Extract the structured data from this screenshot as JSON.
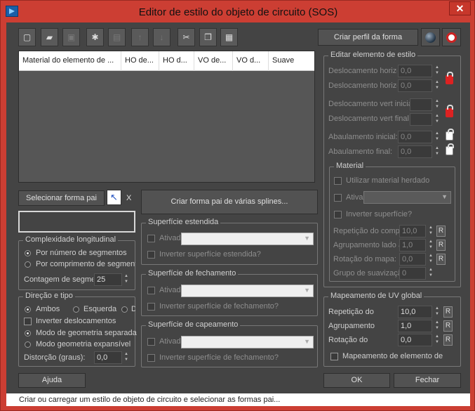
{
  "window": {
    "title": "Editor de estilo do objeto de circuito (SOS)",
    "close": "✕"
  },
  "toolbar": {
    "icons": [
      "new-icon",
      "open-icon",
      "save-icon",
      "add-layer-icon",
      "delete-layer-icon",
      "move-up-icon",
      "move-down-icon",
      "cut-icon",
      "copy-icon",
      "paste-icon"
    ]
  },
  "table": {
    "columns": [
      "Material do elemento de ...",
      "HO de...",
      "HO d...",
      "VO de...",
      "VO d...",
      "Suave"
    ]
  },
  "buttons": {
    "create_profile": "Criar perfil da forma",
    "select_parent": "Selecionar forma pai",
    "clear_x": "X",
    "create_parent_multi": "Criar forma pai de várias splines...",
    "help": "Ajuda",
    "ok": "OK",
    "cancel": "Fechar"
  },
  "complexity": {
    "title": "Complexidade longitudinal",
    "opt_segments": "Por número de segmentos",
    "opt_length": "Por comprimento de segmento",
    "count_label": "Contagem de segmentos",
    "count_value": "25"
  },
  "direction": {
    "title": "Direção e tipo",
    "both": "Ambos",
    "left": "Esquerda",
    "right": "Direita",
    "invert_offsets": "Inverter deslocamentos",
    "separate_geo": "Modo de geometria separada",
    "expandable_geo": "Modo geometria expansível",
    "distortion_label": "Distorção (graus):",
    "distortion_value": "0,0"
  },
  "extended_surface": {
    "title": "Superfície estendida",
    "active": "Ativado",
    "invert": "Inverter superfície estendida?"
  },
  "closing_surface": {
    "title": "Superfície de fechamento",
    "active": "Ativado",
    "invert": "Inverter superfície de fechamento?"
  },
  "capping_surface": {
    "title": "Superfície de capeamento",
    "active": "Ativado",
    "invert": "Inverter superfície de fechamento?"
  },
  "edit_style": {
    "title": "Editar elemento de estilo",
    "h_offset_start": "Deslocamento horizontal inicial:",
    "h_offset_start_value": "0,0",
    "h_offset_end": "Deslocamento horizontal final:",
    "h_offset_end_value": "0,0",
    "v_offset_start": "Deslocamento vert inicial:",
    "v_offset_end": "Deslocamento vert final:",
    "bank_start": "Abaulamento inicial:",
    "bank_start_value": "0,0",
    "bank_end": "Abaulamento final:",
    "bank_end_value": "0,0"
  },
  "material": {
    "title": "Material",
    "use_inherited": "Utilizar material herdado",
    "active": "Ativado",
    "invert_surface": "Inverter superfície?",
    "repeat_len": "Repetição do comprimento:",
    "repeat_len_value": "10,0",
    "group_side": "Agrupamento lado a lado:",
    "group_side_value": "1,0",
    "map_rotation": "Rotação do mapa:",
    "map_rotation_value": "0,0",
    "smoothing_group": "Grupo de suavização:",
    "smoothing_group_value": "0",
    "r": "R"
  },
  "uv": {
    "title": "Mapeamento de UV global",
    "repeat": "Repetição do",
    "repeat_value": "10,0",
    "grouping": "Agrupamento",
    "grouping_value": "1,0",
    "rotation": "Rotação do",
    "rotation_value": "0,0",
    "element_mapping": "Mapeamento de elemento de",
    "r": "R"
  },
  "status": "Criar ou carregar um estilo de objeto de circuito e selecionar as formas pai..."
}
